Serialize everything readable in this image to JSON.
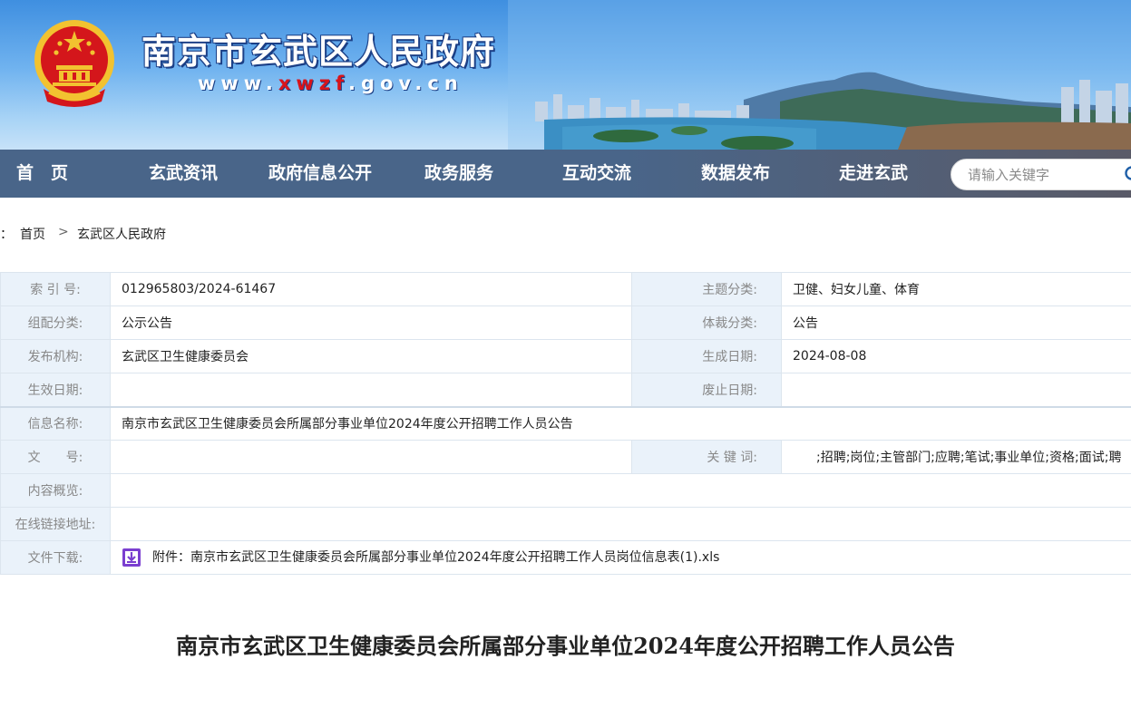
{
  "header": {
    "site_title": "南京市玄武区人民政府",
    "url_prefix": "www.",
    "url_highlight": "xwzf",
    "url_suffix": ".gov.cn"
  },
  "nav": {
    "items": [
      "首　页",
      "玄武资讯",
      "政府信息公开",
      "政务服务",
      "互动交流",
      "数据发布",
      "走进玄武"
    ]
  },
  "search": {
    "placeholder": "请输入关键字"
  },
  "breadcrumb": {
    "prefix": "：",
    "items": [
      "首页",
      "玄武区人民政府"
    ],
    "separator": ">"
  },
  "meta": {
    "index_label": "索 引 号:",
    "index_value": "012965803/2024-61467",
    "theme_label": "主题分类:",
    "theme_value": "卫健、妇女儿童、体育",
    "group_label": "组配分类:",
    "group_value": "公示公告",
    "genre_label": "体裁分类:",
    "genre_value": "公告",
    "publisher_label": "发布机构:",
    "publisher_value": "玄武区卫生健康委员会",
    "created_label": "生成日期:",
    "created_value": "2024-08-08",
    "effective_label": "生效日期:",
    "effective_value": "",
    "abolish_label": "废止日期:",
    "abolish_value": "",
    "name_label": "信息名称:",
    "name_value": "南京市玄武区卫生健康委员会所属部分事业单位2024年度公开招聘工作人员公告",
    "docno_label": "文　　号:",
    "docno_value": "",
    "keywords_label": "关 键 词:",
    "keywords_value": ";招聘;岗位;主管部门;应聘;笔试;事业单位;资格;面试;聘",
    "summary_label": "内容概览:",
    "summary_value": "",
    "link_label": "在线链接地址:",
    "link_value": "",
    "download_label": "文件下载:",
    "download_value": "附件：南京市玄武区卫生健康委员会所属部分事业单位2024年度公开招聘工作人员岗位信息表(1).xls"
  },
  "article": {
    "title": "南京市玄武区卫生健康委员会所属部分事业单位2024年度公开招聘工作人员公告"
  },
  "colors": {
    "nav_bg": "#1c3e6c",
    "label_bg": "#eaf2fa",
    "url_red": "#d8141b",
    "emblem_red": "#d4161b",
    "emblem_gold": "#f2c230"
  }
}
